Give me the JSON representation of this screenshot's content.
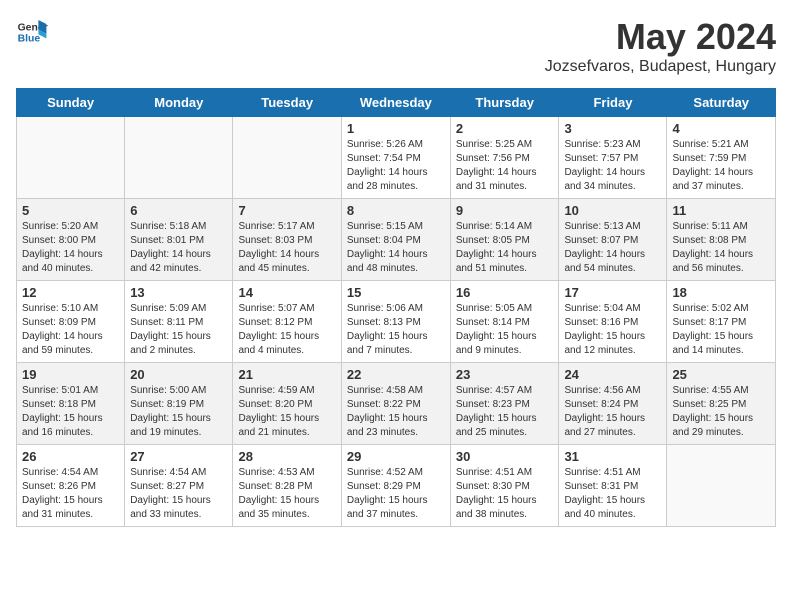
{
  "header": {
    "logo_general": "General",
    "logo_blue": "Blue",
    "month": "May 2024",
    "location": "Jozsefvaros, Budapest, Hungary"
  },
  "days_of_week": [
    "Sunday",
    "Monday",
    "Tuesday",
    "Wednesday",
    "Thursday",
    "Friday",
    "Saturday"
  ],
  "weeks": [
    [
      {
        "day": "",
        "info": ""
      },
      {
        "day": "",
        "info": ""
      },
      {
        "day": "",
        "info": ""
      },
      {
        "day": "1",
        "info": "Sunrise: 5:26 AM\nSunset: 7:54 PM\nDaylight: 14 hours and 28 minutes."
      },
      {
        "day": "2",
        "info": "Sunrise: 5:25 AM\nSunset: 7:56 PM\nDaylight: 14 hours and 31 minutes."
      },
      {
        "day": "3",
        "info": "Sunrise: 5:23 AM\nSunset: 7:57 PM\nDaylight: 14 hours and 34 minutes."
      },
      {
        "day": "4",
        "info": "Sunrise: 5:21 AM\nSunset: 7:59 PM\nDaylight: 14 hours and 37 minutes."
      }
    ],
    [
      {
        "day": "5",
        "info": "Sunrise: 5:20 AM\nSunset: 8:00 PM\nDaylight: 14 hours and 40 minutes."
      },
      {
        "day": "6",
        "info": "Sunrise: 5:18 AM\nSunset: 8:01 PM\nDaylight: 14 hours and 42 minutes."
      },
      {
        "day": "7",
        "info": "Sunrise: 5:17 AM\nSunset: 8:03 PM\nDaylight: 14 hours and 45 minutes."
      },
      {
        "day": "8",
        "info": "Sunrise: 5:15 AM\nSunset: 8:04 PM\nDaylight: 14 hours and 48 minutes."
      },
      {
        "day": "9",
        "info": "Sunrise: 5:14 AM\nSunset: 8:05 PM\nDaylight: 14 hours and 51 minutes."
      },
      {
        "day": "10",
        "info": "Sunrise: 5:13 AM\nSunset: 8:07 PM\nDaylight: 14 hours and 54 minutes."
      },
      {
        "day": "11",
        "info": "Sunrise: 5:11 AM\nSunset: 8:08 PM\nDaylight: 14 hours and 56 minutes."
      }
    ],
    [
      {
        "day": "12",
        "info": "Sunrise: 5:10 AM\nSunset: 8:09 PM\nDaylight: 14 hours and 59 minutes."
      },
      {
        "day": "13",
        "info": "Sunrise: 5:09 AM\nSunset: 8:11 PM\nDaylight: 15 hours and 2 minutes."
      },
      {
        "day": "14",
        "info": "Sunrise: 5:07 AM\nSunset: 8:12 PM\nDaylight: 15 hours and 4 minutes."
      },
      {
        "day": "15",
        "info": "Sunrise: 5:06 AM\nSunset: 8:13 PM\nDaylight: 15 hours and 7 minutes."
      },
      {
        "day": "16",
        "info": "Sunrise: 5:05 AM\nSunset: 8:14 PM\nDaylight: 15 hours and 9 minutes."
      },
      {
        "day": "17",
        "info": "Sunrise: 5:04 AM\nSunset: 8:16 PM\nDaylight: 15 hours and 12 minutes."
      },
      {
        "day": "18",
        "info": "Sunrise: 5:02 AM\nSunset: 8:17 PM\nDaylight: 15 hours and 14 minutes."
      }
    ],
    [
      {
        "day": "19",
        "info": "Sunrise: 5:01 AM\nSunset: 8:18 PM\nDaylight: 15 hours and 16 minutes."
      },
      {
        "day": "20",
        "info": "Sunrise: 5:00 AM\nSunset: 8:19 PM\nDaylight: 15 hours and 19 minutes."
      },
      {
        "day": "21",
        "info": "Sunrise: 4:59 AM\nSunset: 8:20 PM\nDaylight: 15 hours and 21 minutes."
      },
      {
        "day": "22",
        "info": "Sunrise: 4:58 AM\nSunset: 8:22 PM\nDaylight: 15 hours and 23 minutes."
      },
      {
        "day": "23",
        "info": "Sunrise: 4:57 AM\nSunset: 8:23 PM\nDaylight: 15 hours and 25 minutes."
      },
      {
        "day": "24",
        "info": "Sunrise: 4:56 AM\nSunset: 8:24 PM\nDaylight: 15 hours and 27 minutes."
      },
      {
        "day": "25",
        "info": "Sunrise: 4:55 AM\nSunset: 8:25 PM\nDaylight: 15 hours and 29 minutes."
      }
    ],
    [
      {
        "day": "26",
        "info": "Sunrise: 4:54 AM\nSunset: 8:26 PM\nDaylight: 15 hours and 31 minutes."
      },
      {
        "day": "27",
        "info": "Sunrise: 4:54 AM\nSunset: 8:27 PM\nDaylight: 15 hours and 33 minutes."
      },
      {
        "day": "28",
        "info": "Sunrise: 4:53 AM\nSunset: 8:28 PM\nDaylight: 15 hours and 35 minutes."
      },
      {
        "day": "29",
        "info": "Sunrise: 4:52 AM\nSunset: 8:29 PM\nDaylight: 15 hours and 37 minutes."
      },
      {
        "day": "30",
        "info": "Sunrise: 4:51 AM\nSunset: 8:30 PM\nDaylight: 15 hours and 38 minutes."
      },
      {
        "day": "31",
        "info": "Sunrise: 4:51 AM\nSunset: 8:31 PM\nDaylight: 15 hours and 40 minutes."
      },
      {
        "day": "",
        "info": ""
      }
    ]
  ]
}
